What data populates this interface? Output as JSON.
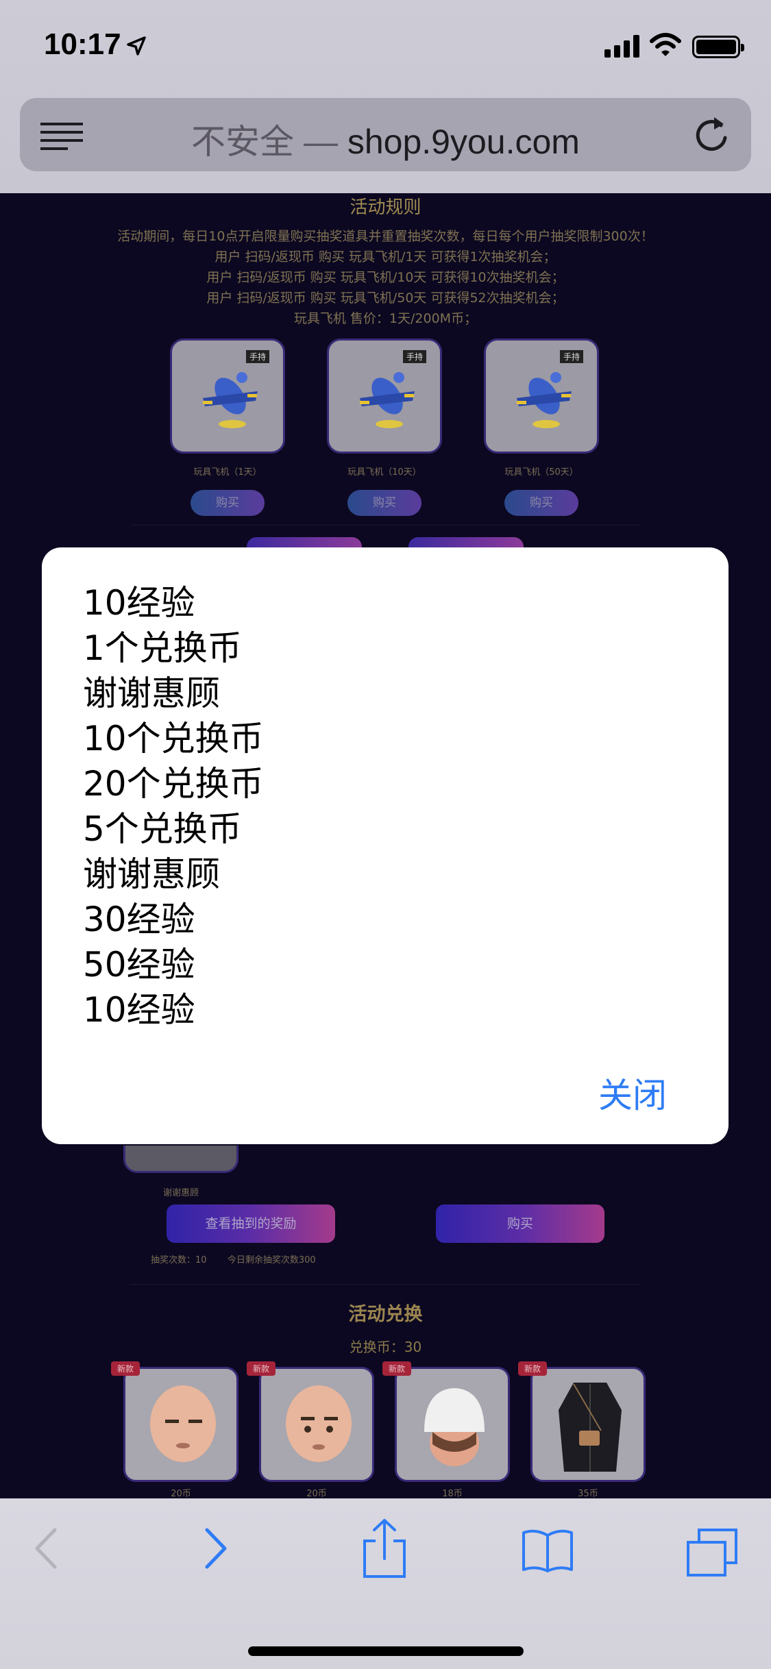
{
  "status_bar": {
    "time": "10:17"
  },
  "address_bar": {
    "insecure_label": "不安全 —",
    "domain": "shop.9you.com"
  },
  "rules": {
    "title": "活动规则",
    "lines": [
      "活动期间，每日10点开启限量购买抽奖道具并重置抽奖次数，每日每个用户抽奖限制300次！",
      "用户 扫码/返现币 购买 玩具飞机/1天 可获得1次抽奖机会；",
      "用户 扫码/返现币 购买 玩具飞机/10天 可获得10次抽奖机会；",
      "用户 扫码/返现币 购买 玩具飞机/50天 可获得52次抽奖机会；",
      "玩具飞机 售价：1天/200M币；"
    ]
  },
  "products": [
    {
      "tag": "手持",
      "name": "玩具飞机（1天）",
      "buy": "购买"
    },
    {
      "tag": "手持",
      "name": "玩具飞机（10天）",
      "buy": "购买"
    },
    {
      "tag": "手持",
      "name": "玩具飞机（50天）",
      "buy": "购买"
    }
  ],
  "lottery": {
    "peek_label": "谢谢惠顾",
    "view_prizes": "查看抽到的奖励",
    "buy": "购买",
    "draw_count": "抽奖次数：10",
    "remaining": "今日剩余抽奖次数300"
  },
  "exchange": {
    "title": "活动兑换",
    "coins": "兑换币：30",
    "items": [
      {
        "badge": "新款",
        "price": "20币"
      },
      {
        "badge": "新款",
        "price": "20币"
      },
      {
        "badge": "新款",
        "price": "18币"
      },
      {
        "badge": "新款",
        "price": "35币"
      }
    ]
  },
  "modal": {
    "prizes": [
      "10经验",
      "1个兑换币",
      "谢谢惠顾",
      "10个兑换币",
      "20个兑换币",
      "5个兑换币",
      "谢谢惠顾",
      "30经验",
      "50经验",
      "10经验"
    ],
    "close": "关闭"
  },
  "colors": {
    "accent": "#2e7cf6",
    "page_bg": "#0c0821",
    "gold_text": "#a08c50"
  }
}
